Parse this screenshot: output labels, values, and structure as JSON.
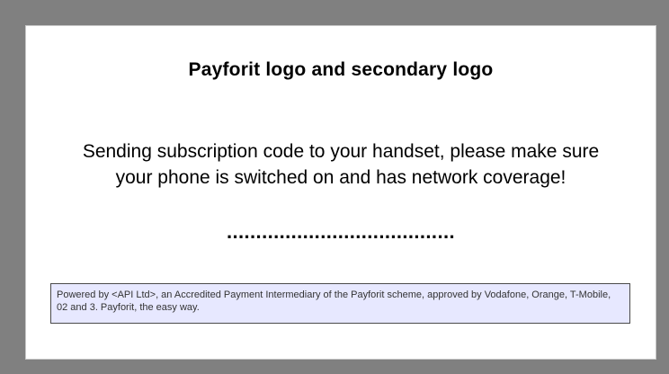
{
  "panel": {
    "title": "Payforit logo and secondary logo",
    "message_line1": "Sending subscription code to your handset, please make sure",
    "message_line2": "your phone is switched on and has network coverage!",
    "progress_dots": ".......................................",
    "footer_text": "Powered by <API Ltd>, an Accredited Payment Intermediary of the Payforit scheme, approved by Vodafone, Orange, T-Mobile, 02 and 3.  Payforit, the easy way."
  },
  "colors": {
    "outer_background": "#808080",
    "panel_background": "#ffffff",
    "footer_background": "#e7e8ff",
    "footer_border": "#4a4a4a"
  }
}
